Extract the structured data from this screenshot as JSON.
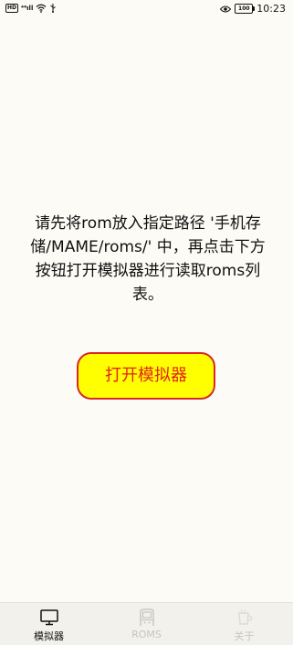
{
  "status_bar": {
    "hd_badge": "HD",
    "signal_text": "⁴⁶ıll",
    "battery": "100",
    "time": "10:23"
  },
  "main": {
    "message": "请先将rom放入指定路径 '手机存储/MAME/roms/' 中，再点击下方按钮打开模拟器进行读取roms列表。",
    "open_button_label": "打开模拟器"
  },
  "tabs": [
    {
      "label": "模拟器",
      "icon": "monitor-icon",
      "active": true
    },
    {
      "label": "ROMS",
      "icon": "arcade-cabinet-icon",
      "active": false
    },
    {
      "label": "关于",
      "icon": "cup-icon",
      "active": false
    }
  ],
  "colors": {
    "background": "#fcfbf6",
    "button_fill": "#ffff00",
    "button_border": "#d9262b",
    "button_text": "#e2231a",
    "tab_active": "#111111",
    "tab_inactive": "#c6c5c1"
  }
}
